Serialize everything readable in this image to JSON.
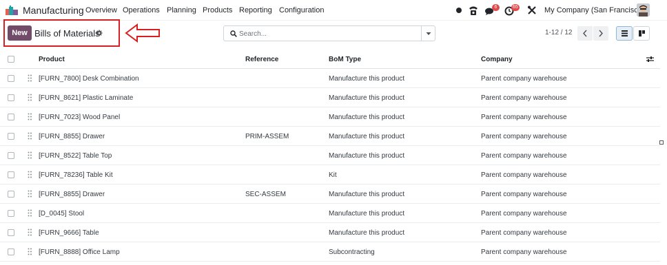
{
  "header": {
    "app_name": "Manufacturing",
    "menu": [
      "Overview",
      "Operations",
      "Planning",
      "Products",
      "Reporting",
      "Configuration"
    ],
    "chat_badge": "6",
    "activity_badge": "65",
    "company": "My Company (San Francisco)"
  },
  "control": {
    "new_label": "New",
    "title": "Bills of Materials",
    "search_placeholder": "Search...",
    "pager": "1-12 / 12"
  },
  "table": {
    "columns": [
      "Product",
      "Reference",
      "BoM Type",
      "Company"
    ],
    "rows": [
      {
        "product": "[FURN_7800] Desk Combination",
        "reference": "",
        "type": "Manufacture this product",
        "company": "Parent company warehouse"
      },
      {
        "product": "[FURN_8621] Plastic Laminate",
        "reference": "",
        "type": "Manufacture this product",
        "company": "Parent company warehouse"
      },
      {
        "product": "[FURN_7023] Wood Panel",
        "reference": "",
        "type": "Manufacture this product",
        "company": "Parent company warehouse"
      },
      {
        "product": "[FURN_8855] Drawer",
        "reference": "PRIM-ASSEM",
        "type": "Manufacture this product",
        "company": "Parent company warehouse"
      },
      {
        "product": "[FURN_8522] Table Top",
        "reference": "",
        "type": "Manufacture this product",
        "company": "Parent company warehouse"
      },
      {
        "product": "[FURN_78236] Table Kit",
        "reference": "",
        "type": "Kit",
        "company": "Parent company warehouse"
      },
      {
        "product": "[FURN_8855] Drawer",
        "reference": "SEC-ASSEM",
        "type": "Manufacture this product",
        "company": "Parent company warehouse"
      },
      {
        "product": "[D_0045] Stool",
        "reference": "",
        "type": "Manufacture this product",
        "company": "Parent company warehouse"
      },
      {
        "product": "[FURN_9666] Table",
        "reference": "",
        "type": "Manufacture this product",
        "company": "Parent company warehouse"
      },
      {
        "product": "[FURN_8888] Office Lamp",
        "reference": "",
        "type": "Subcontracting",
        "company": "Parent company warehouse"
      }
    ]
  },
  "colors": {
    "brand": "#714b67",
    "highlight": "#d81e1e",
    "badge": "#e04a4a"
  },
  "icons": [
    "app-logo-icon",
    "status-dot-icon",
    "phone-icon",
    "chat-icon",
    "clock-icon",
    "tools-icon",
    "gear-icon",
    "search-icon",
    "caret-down-icon",
    "chevron-left-icon",
    "chevron-right-icon",
    "list-view-icon",
    "kanban-view-icon",
    "optional-columns-icon",
    "drag-handle-icon",
    "red-arrow-icon"
  ]
}
